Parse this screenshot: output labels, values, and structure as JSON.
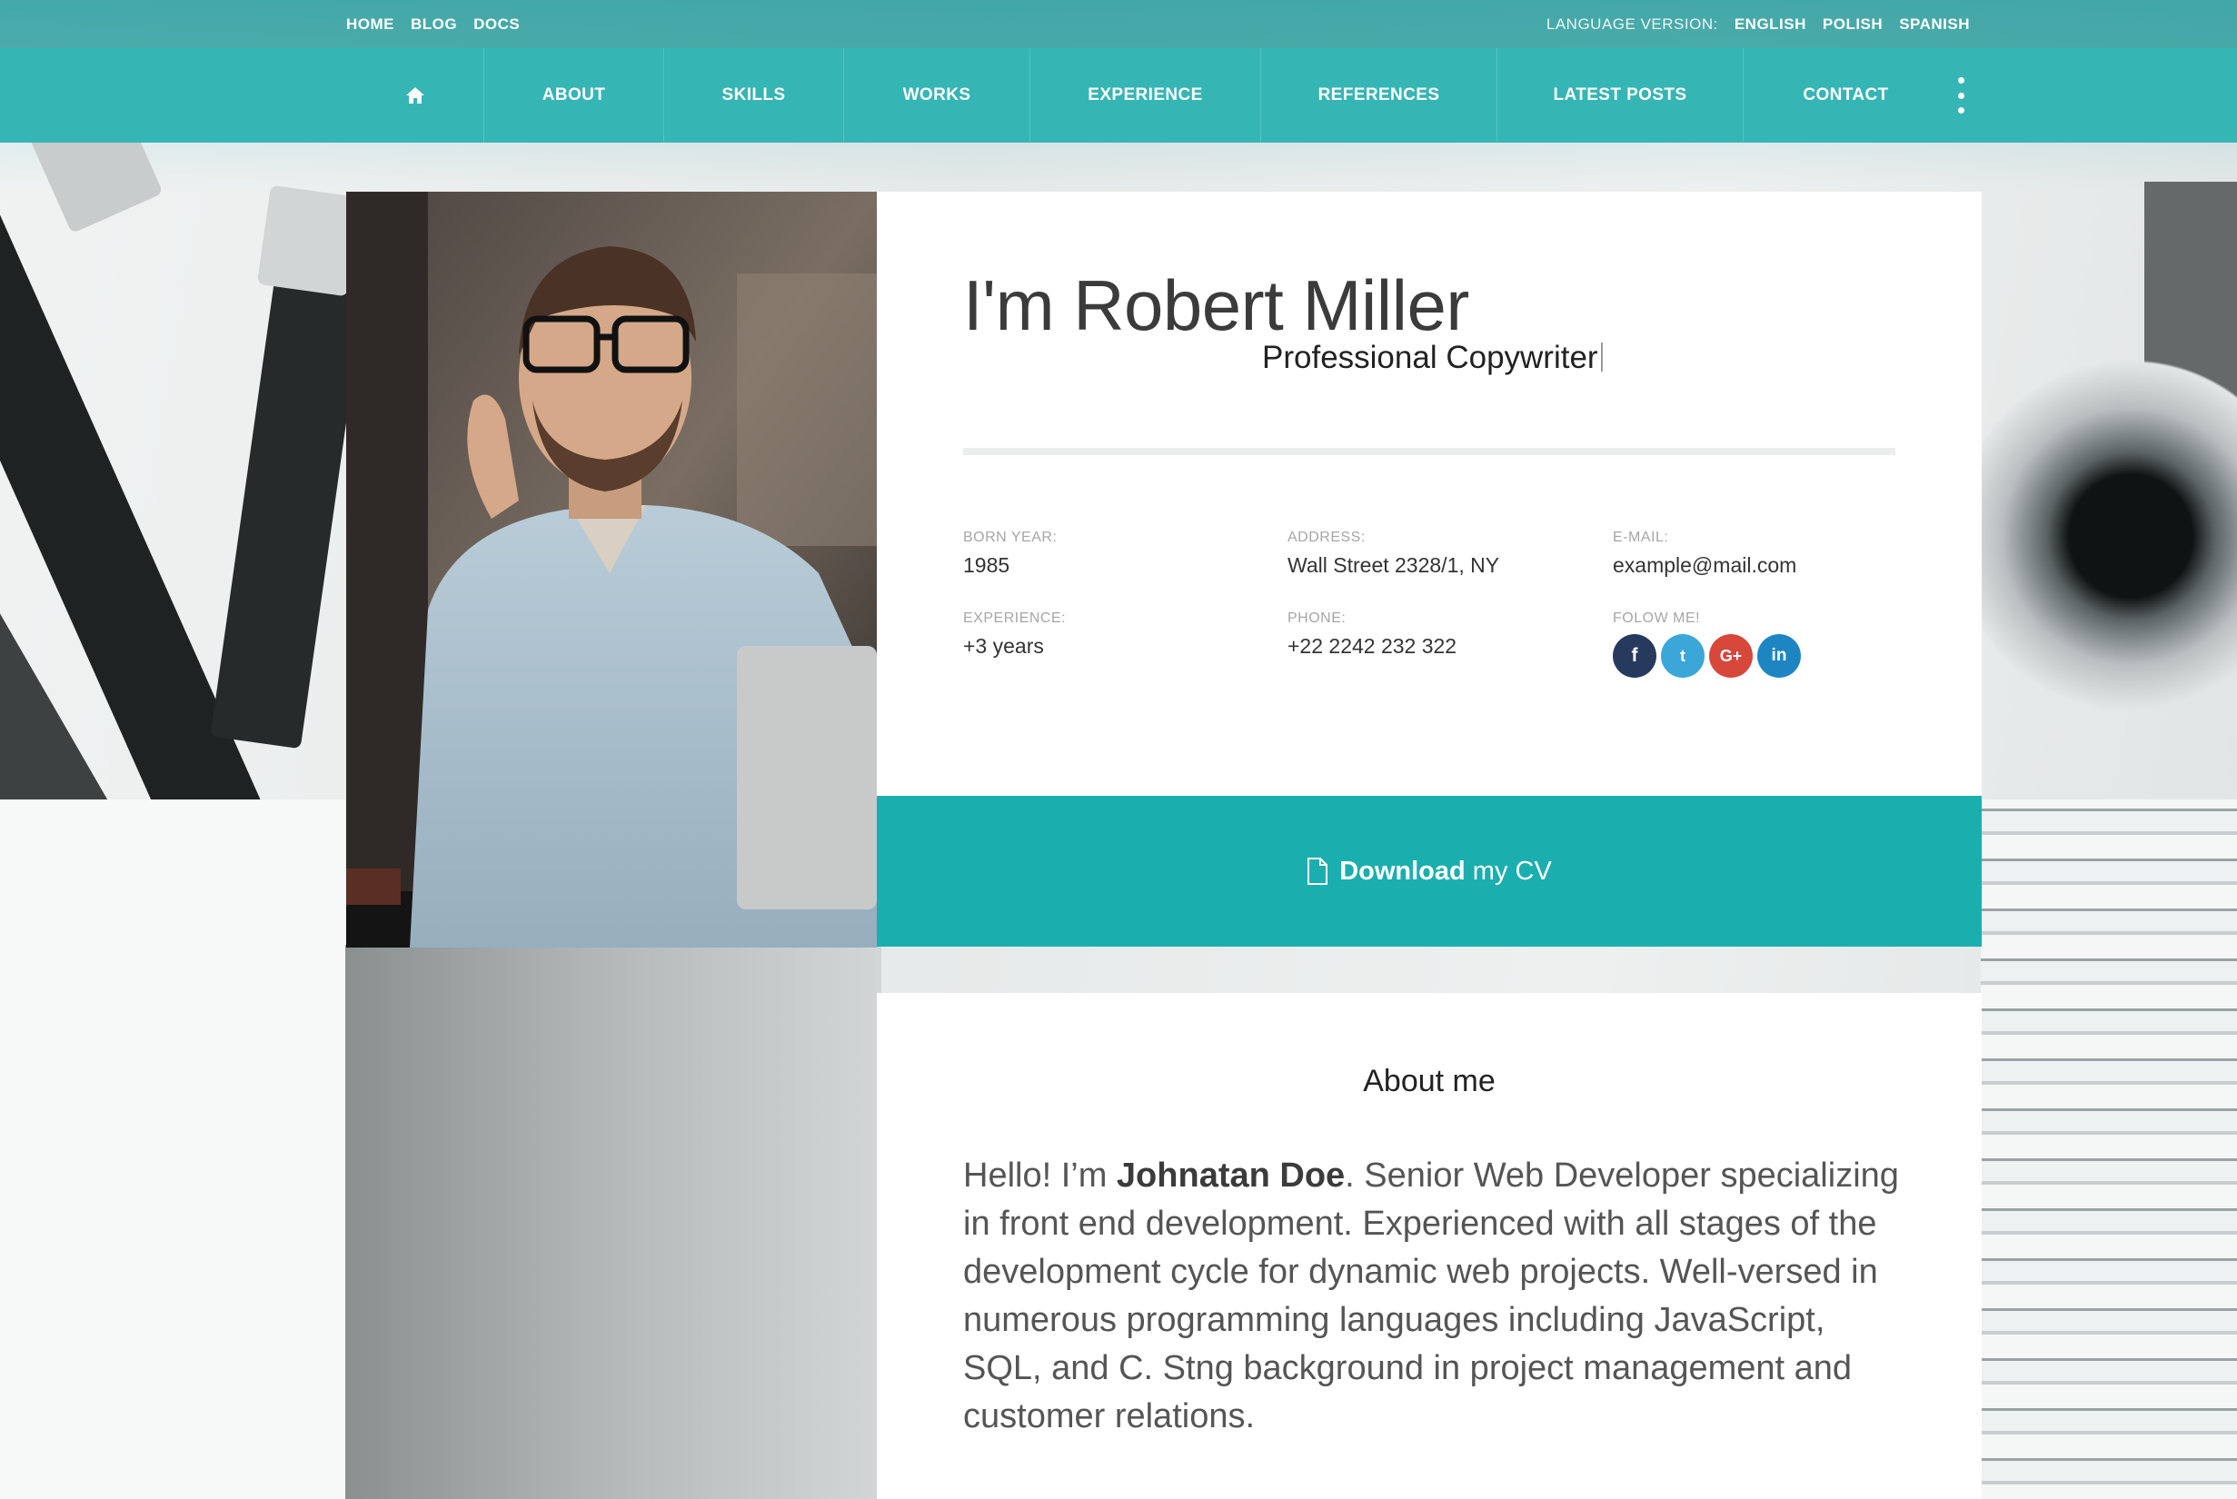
{
  "topbar": {
    "links": [
      "HOME",
      "BLOG",
      "DOCS"
    ],
    "language_label": "LANGUAGE VERSION:",
    "languages": [
      "ENGLISH",
      "POLISH",
      "SPANISH"
    ]
  },
  "nav": {
    "home_icon": "home-icon",
    "items": [
      "ABOUT",
      "SKILLS",
      "WORKS",
      "EXPERIENCE",
      "REFERENCES",
      "LATEST POSTS",
      "CONTACT"
    ],
    "more_icon": "vertical-dots-icon"
  },
  "profile": {
    "name": "I'm Robert Miller",
    "title": "Professional Copywriter",
    "born_label": "BORN YEAR:",
    "born_value": "1985",
    "address_label": "ADDRESS:",
    "address_value": "Wall Street 2328/1, NY",
    "email_label": "E-MAIL:",
    "email_value": "example@mail.com",
    "experience_label": "EXPERIENCE:",
    "experience_value": "+3 years",
    "phone_label": "PHONE:",
    "phone_value": "+22 2242 232 322",
    "follow_label": "FOLOW ME!",
    "social": [
      {
        "icon": "facebook-icon",
        "glyph": "f",
        "color": "#263a5e"
      },
      {
        "icon": "twitter-icon",
        "glyph": "t",
        "color": "#3aa7d8"
      },
      {
        "icon": "google-plus-icon",
        "glyph": "G+",
        "color": "#d7473a"
      },
      {
        "icon": "linkedin-icon",
        "glyph": "in",
        "color": "#1d86c2"
      }
    ]
  },
  "download": {
    "icon": "file-icon",
    "bold": "Download",
    "rest": "my CV"
  },
  "about": {
    "heading": "About me",
    "text_before": "Hello! I’m ",
    "text_name": "Johnatan Doe",
    "text_after": ". Senior Web Developer specializing in front end development. Experienced with all stages of the development cycle for dynamic web projects. Well-versed in numerous programming languages including JavaScript, SQL, and C. Stng background in project management and customer relations."
  },
  "colors": {
    "accent": "#1aafae",
    "nav": "#36b5b5"
  }
}
